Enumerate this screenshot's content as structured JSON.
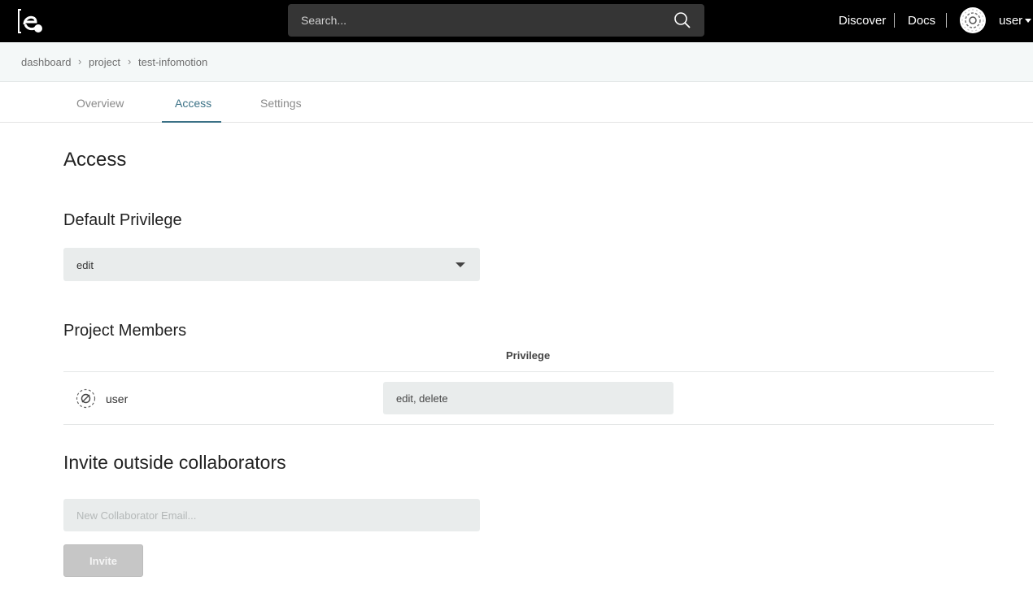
{
  "header": {
    "logo_icon": "e-logo-icon",
    "search_placeholder": "Search...",
    "search_icon": "search-icon",
    "nav": {
      "discover": "Discover",
      "docs": "Docs"
    },
    "user_label": "user"
  },
  "breadcrumb": [
    "dashboard",
    "project",
    "test-infomotion"
  ],
  "breadcrumb_separator": "›",
  "tabs": [
    {
      "label": "Overview",
      "active": false
    },
    {
      "label": "Access",
      "active": true
    },
    {
      "label": "Settings",
      "active": false
    }
  ],
  "page": {
    "title": "Access",
    "default_privilege": {
      "heading": "Default Privilege",
      "selected": "edit"
    },
    "members": {
      "heading": "Project Members",
      "column_privilege": "Privilege",
      "rows": [
        {
          "name": "user",
          "privilege": "edit, delete"
        }
      ]
    },
    "invite": {
      "heading": "Invite outside collaborators",
      "email_placeholder": "New Collaborator Email...",
      "button_label": "Invite"
    }
  },
  "colors": {
    "accent": "#3b7186",
    "topbar": "#000000",
    "field_bg": "#e9ecec"
  }
}
